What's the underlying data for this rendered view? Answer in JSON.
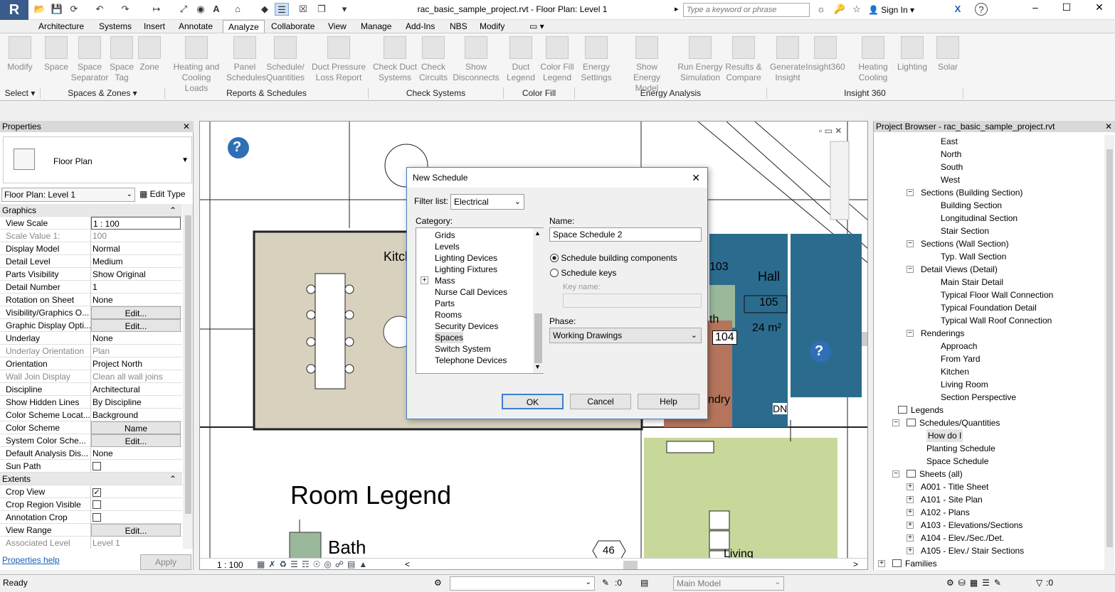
{
  "window": {
    "title": "rac_basic_sample_project.rvt - Floor Plan: Level 1",
    "search_placeholder": "Type a keyword or phrase",
    "signin": "Sign In",
    "app_letter": "R"
  },
  "tabs": [
    "Architecture",
    "Systems",
    "Insert",
    "Annotate",
    "Analyze",
    "Collaborate",
    "View",
    "Manage",
    "Add-Ins",
    "NBS",
    "Modify"
  ],
  "ribbon": {
    "buttons": [
      {
        "l1": "Modify",
        "l2": ""
      },
      {
        "l1": "Space",
        "l2": ""
      },
      {
        "l1": "Space",
        "l2": "Separator"
      },
      {
        "l1": "Space",
        "l2": "Tag"
      },
      {
        "l1": "Zone",
        "l2": ""
      },
      {
        "l1": "Heating and",
        "l2": "Cooling Loads"
      },
      {
        "l1": "Panel",
        "l2": "Schedules"
      },
      {
        "l1": "Schedule/",
        "l2": "Quantities"
      },
      {
        "l1": "Duct Pressure",
        "l2": "Loss Report"
      },
      {
        "l1": "Check Duct",
        "l2": "Systems"
      },
      {
        "l1": "Check",
        "l2": "Circuits"
      },
      {
        "l1": "Show",
        "l2": "Disconnects"
      },
      {
        "l1": "Duct",
        "l2": "Legend"
      },
      {
        "l1": "Color Fill",
        "l2": "Legend"
      },
      {
        "l1": "Energy",
        "l2": "Settings"
      },
      {
        "l1": "Show",
        "l2": "Energy Model"
      },
      {
        "l1": "Run Energy",
        "l2": "Simulation"
      },
      {
        "l1": "Results &",
        "l2": "Compare"
      },
      {
        "l1": "Generate",
        "l2": "Insight"
      },
      {
        "l1": "Insight360",
        "l2": ""
      },
      {
        "l1": "Heating",
        "l2": "Cooling"
      },
      {
        "l1": "Lighting",
        "l2": ""
      },
      {
        "l1": "Solar",
        "l2": ""
      }
    ],
    "panels": [
      "Select",
      "Spaces & Zones",
      "Reports & Schedules",
      "Check Systems",
      "Color Fill",
      "Energy Analysis",
      "Insight 360"
    ]
  },
  "properties": {
    "title": "Properties",
    "type_name": "Floor Plan",
    "type_selector": "Floor Plan: Level 1",
    "edit_type": "Edit Type",
    "rows": [
      {
        "k": "Graphics",
        "v": "",
        "s": "sect"
      },
      {
        "k": "View Scale",
        "v": "1 : 100",
        "s": "input"
      },
      {
        "k": "Scale Value    1:",
        "v": "100",
        "s": "gray"
      },
      {
        "k": "Display Model",
        "v": "Normal"
      },
      {
        "k": "Detail Level",
        "v": "Medium"
      },
      {
        "k": "Parts Visibility",
        "v": "Show Original"
      },
      {
        "k": "Detail Number",
        "v": "1"
      },
      {
        "k": "Rotation on Sheet",
        "v": "None"
      },
      {
        "k": "Visibility/Graphics O...",
        "v": "Edit...",
        "s": "btn"
      },
      {
        "k": "Graphic Display Opti...",
        "v": "Edit...",
        "s": "btn"
      },
      {
        "k": "Underlay",
        "v": "None"
      },
      {
        "k": "Underlay Orientation",
        "v": "Plan",
        "s": "gray"
      },
      {
        "k": "Orientation",
        "v": "Project North"
      },
      {
        "k": "Wall Join Display",
        "v": "Clean all wall joins",
        "s": "gray"
      },
      {
        "k": "Discipline",
        "v": "Architectural"
      },
      {
        "k": "Show Hidden Lines",
        "v": "By Discipline"
      },
      {
        "k": "Color Scheme Locat...",
        "v": "Background"
      },
      {
        "k": "Color Scheme",
        "v": "Name",
        "s": "btn"
      },
      {
        "k": "System Color Sche...",
        "v": "Edit...",
        "s": "btn"
      },
      {
        "k": "Default Analysis Dis...",
        "v": "None"
      },
      {
        "k": "Sun Path",
        "v": "",
        "s": "check"
      },
      {
        "k": "Extents",
        "v": "",
        "s": "sect"
      },
      {
        "k": "Crop View",
        "v": "",
        "s": "checked"
      },
      {
        "k": "Crop Region Visible",
        "v": "",
        "s": "check"
      },
      {
        "k": "Annotation Crop",
        "v": "",
        "s": "check"
      },
      {
        "k": "View Range",
        "v": "Edit...",
        "s": "btn"
      },
      {
        "k": "Associated Level",
        "v": "Level 1",
        "s": "gray"
      }
    ],
    "help": "Properties help",
    "apply": "Apply"
  },
  "canvas": {
    "scale": "1 : 100",
    "room_legend": "Room Legend",
    "legend_bath": "Bath",
    "rooms": {
      "kitchen": "Kitch",
      "hall": "Hall",
      "num105": "105",
      "area": "24 m²",
      "num103": "103",
      "num104": "104",
      "laundry": "ndry",
      "dn": "DN",
      "living": "Living",
      "tag46": "46",
      "th": "th"
    }
  },
  "dialog": {
    "title": "New Schedule",
    "filter_label": "Filter list:",
    "filter_value": "Electrical",
    "category_label": "Category:",
    "categories": [
      "Grids",
      "Levels",
      "Lighting Devices",
      "Lighting Fixtures",
      "Mass",
      "Nurse Call Devices",
      "Parts",
      "Rooms",
      "Security Devices",
      "Spaces",
      "Switch System",
      "Telephone Devices"
    ],
    "selected": "Spaces",
    "name_label": "Name:",
    "name_value": "Space Schedule 2",
    "radio1": "Schedule building components",
    "radio2": "Schedule keys",
    "key_name": "Key name:",
    "phase_label": "Phase:",
    "phase_value": "Working Drawings",
    "ok": "OK",
    "cancel": "Cancel",
    "help": "Help"
  },
  "browser": {
    "title": "Project Browser - rac_basic_sample_project.rvt",
    "items": [
      {
        "t": "East",
        "d": 3
      },
      {
        "t": "North",
        "d": 3
      },
      {
        "t": "South",
        "d": 3
      },
      {
        "t": "West",
        "d": 3
      },
      {
        "t": "Sections (Building Section)",
        "d": 2,
        "e": "-"
      },
      {
        "t": "Building Section",
        "d": 3
      },
      {
        "t": "Longitudinal Section",
        "d": 3
      },
      {
        "t": "Stair Section",
        "d": 3
      },
      {
        "t": "Sections (Wall Section)",
        "d": 2,
        "e": "-"
      },
      {
        "t": "Typ. Wall Section",
        "d": 3
      },
      {
        "t": "Detail Views (Detail)",
        "d": 2,
        "e": "-"
      },
      {
        "t": "Main Stair Detail",
        "d": 3
      },
      {
        "t": "Typical Floor Wall Connection",
        "d": 3
      },
      {
        "t": "Typical Foundation Detail",
        "d": 3
      },
      {
        "t": "Typical Wall Roof Connection",
        "d": 3
      },
      {
        "t": "Renderings",
        "d": 2,
        "e": "-"
      },
      {
        "t": "Approach",
        "d": 3
      },
      {
        "t": "From Yard",
        "d": 3
      },
      {
        "t": "Kitchen",
        "d": 3
      },
      {
        "t": "Living Room",
        "d": 3
      },
      {
        "t": "Section Perspective",
        "d": 3
      },
      {
        "t": "Legends",
        "d": 1,
        "i": true
      },
      {
        "t": "Schedules/Quantities",
        "d": 1,
        "e": "-",
        "i": true
      },
      {
        "t": "How do I",
        "d": 2,
        "h": true
      },
      {
        "t": "Planting Schedule",
        "d": 2
      },
      {
        "t": "Space Schedule",
        "d": 2
      },
      {
        "t": "Sheets (all)",
        "d": 1,
        "e": "-",
        "i": true
      },
      {
        "t": "A001 - Title Sheet",
        "d": 2,
        "e": "+"
      },
      {
        "t": "A101 - Site Plan",
        "d": 2,
        "e": "+"
      },
      {
        "t": "A102 - Plans",
        "d": 2,
        "e": "+"
      },
      {
        "t": "A103 - Elevations/Sections",
        "d": 2,
        "e": "+"
      },
      {
        "t": "A104 - Elev./Sec./Det.",
        "d": 2,
        "e": "+"
      },
      {
        "t": "A105 - Elev./ Stair Sections",
        "d": 2,
        "e": "+"
      },
      {
        "t": "Families",
        "d": 0,
        "e": "+",
        "i": true
      }
    ]
  },
  "status": {
    "text": "Ready",
    "model": "Main Model",
    "count0": ":0",
    "count1": ":0"
  }
}
